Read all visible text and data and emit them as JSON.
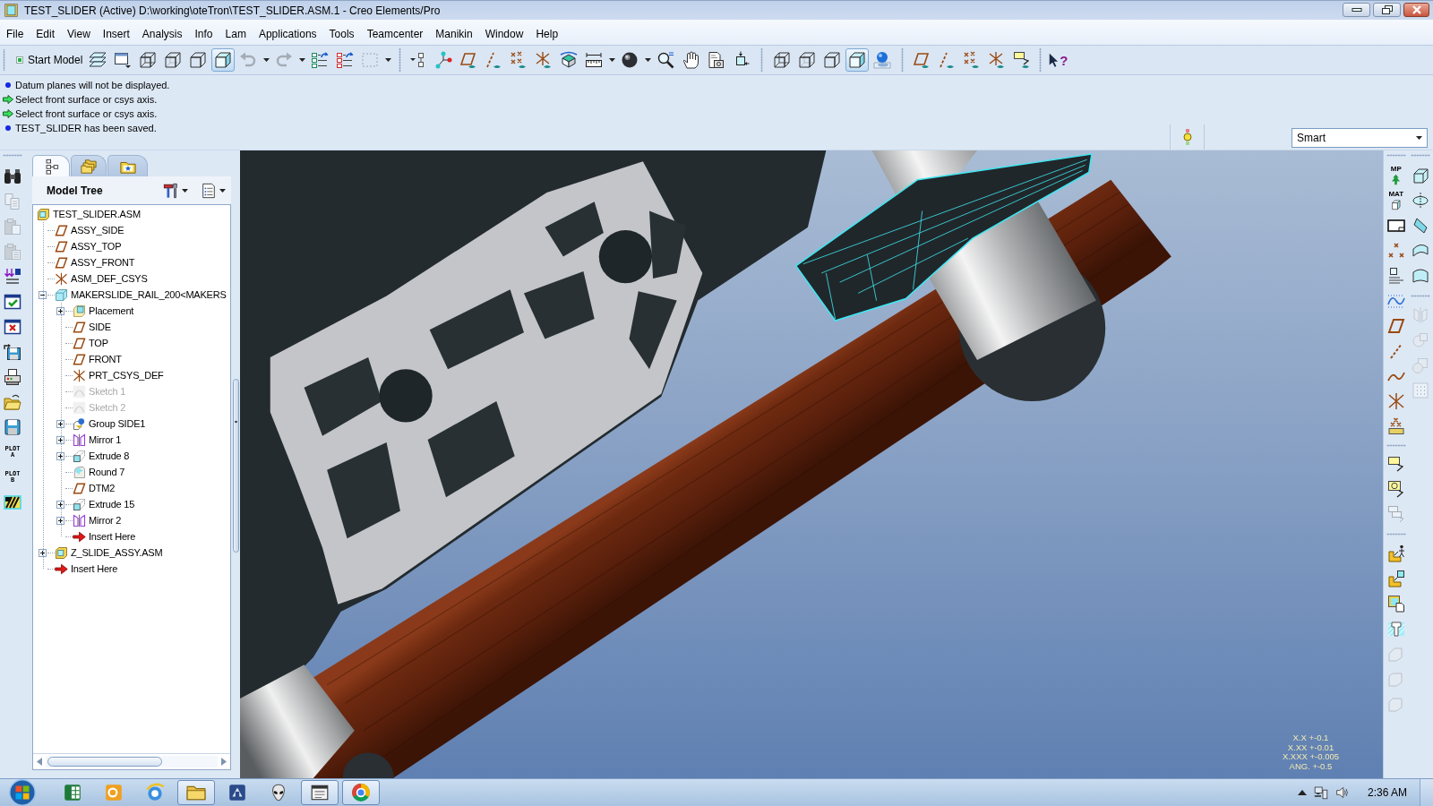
{
  "window": {
    "title": "TEST_SLIDER (Active) D:\\working\\oteTron\\TEST_SLIDER.ASM.1 - Creo Elements/Pro"
  },
  "menu": [
    "File",
    "Edit",
    "View",
    "Insert",
    "Analysis",
    "Info",
    "Lam",
    "Applications",
    "Tools",
    "Teamcenter",
    "Manikin",
    "Window",
    "Help"
  ],
  "toolbar": {
    "start_model": "Start Model",
    "groups": [
      [
        {
          "disabled": false,
          "pressed": false
        },
        {
          "disabled": false,
          "pressed": false
        },
        {
          "disabled": false,
          "pressed": false
        },
        {
          "disabled": false,
          "pressed": false
        },
        {
          "disabled": false,
          "pressed": false
        },
        {
          "disabled": false,
          "pressed": true
        },
        {
          "disabled": true,
          "pressed": false
        },
        {
          "disabled": true,
          "pressed": false
        },
        {
          "disabled": false,
          "pressed": false
        },
        {
          "disabled": false,
          "pressed": false
        },
        {
          "disabled": true,
          "pressed": false
        }
      ],
      [
        {
          "disabled": false,
          "pressed": false
        },
        {
          "disabled": false,
          "pressed": false
        },
        {
          "disabled": false,
          "pressed": false
        },
        {
          "disabled": false,
          "pressed": false
        },
        {
          "disabled": false,
          "pressed": false
        },
        {
          "disabled": false,
          "pressed": false
        },
        {
          "disabled": false,
          "pressed": false
        },
        {
          "disabled": false,
          "pressed": false
        },
        {
          "disabled": false,
          "pressed": false
        },
        {
          "disabled": false,
          "pressed": false
        },
        {
          "disabled": false,
          "pressed": false
        },
        {
          "disabled": false,
          "pressed": false
        },
        {
          "disabled": false,
          "pressed": false
        }
      ],
      [
        {
          "disabled": false,
          "pressed": false
        },
        {
          "disabled": false,
          "pressed": false
        },
        {
          "disabled": false,
          "pressed": false
        },
        {
          "disabled": false,
          "pressed": true
        },
        {
          "disabled": false,
          "pressed": false
        }
      ],
      [
        {
          "disabled": false,
          "pressed": false
        },
        {
          "disabled": false,
          "pressed": false
        },
        {
          "disabled": false,
          "pressed": false
        },
        {
          "disabled": false,
          "pressed": false
        },
        {
          "disabled": false,
          "pressed": false
        }
      ],
      [
        {
          "disabled": false,
          "pressed": false,
          "mark": "?"
        }
      ]
    ]
  },
  "messages": [
    {
      "kind": "info",
      "text": "Datum planes will not be displayed."
    },
    {
      "kind": "prompt",
      "text": "Select front surface or csys axis."
    },
    {
      "kind": "prompt",
      "text": "Select front surface or csys axis."
    },
    {
      "kind": "info",
      "text": "TEST_SLIDER has been saved."
    }
  ],
  "selection_filter": {
    "value": "Smart"
  },
  "left_toolbar": [
    {
      "disabled": false
    },
    {
      "disabled": true
    },
    {
      "disabled": true
    },
    {
      "disabled": true
    },
    {
      "disabled": false
    },
    {
      "disabled": false
    },
    {
      "disabled": false
    },
    {
      "disabled": false
    },
    {
      "disabled": false
    },
    {
      "disabled": false
    },
    {
      "disabled": false
    },
    {
      "disabled": false,
      "label": "PLOT",
      "sublabel": "A"
    },
    {
      "disabled": false,
      "label": "PLOT",
      "sublabel": "B"
    },
    {
      "disabled": false
    }
  ],
  "model_tree": {
    "tabs": [
      {
        "selected": true
      },
      {
        "selected": false
      },
      {
        "selected": false
      }
    ],
    "title": "Model Tree",
    "items": [
      {
        "label": "TEST_SLIDER.ASM",
        "kind": "assembly",
        "dimmed": false,
        "children": [
          {
            "label": "ASSY_SIDE",
            "kind": "datum-plane",
            "dimmed": false
          },
          {
            "label": "ASSY_TOP",
            "kind": "datum-plane",
            "dimmed": false
          },
          {
            "label": "ASSY_FRONT",
            "kind": "datum-plane",
            "dimmed": false
          },
          {
            "label": "ASM_DEF_CSYS",
            "kind": "csys",
            "dimmed": false
          },
          {
            "label": "MAKERSLIDE_RAIL_200<MAKERS",
            "kind": "part",
            "dimmed": false,
            "expanded": true,
            "children": [
              {
                "label": "Placement",
                "kind": "placement",
                "dimmed": false,
                "expanded": false
              },
              {
                "label": "SIDE",
                "kind": "datum-plane",
                "dimmed": false
              },
              {
                "label": "TOP",
                "kind": "datum-plane",
                "dimmed": false
              },
              {
                "label": "FRONT",
                "kind": "datum-plane",
                "dimmed": false
              },
              {
                "label": "PRT_CSYS_DEF",
                "kind": "csys",
                "dimmed": false
              },
              {
                "label": "Sketch 1",
                "kind": "sketch",
                "dimmed": true
              },
              {
                "label": "Sketch 2",
                "kind": "sketch",
                "dimmed": true
              },
              {
                "label": "Group SIDE1",
                "kind": "group",
                "dimmed": false,
                "expanded": false
              },
              {
                "label": "Mirror 1",
                "kind": "mirror",
                "dimmed": false,
                "expanded": false
              },
              {
                "label": "Extrude 8",
                "kind": "extrude",
                "dimmed": false,
                "expanded": false
              },
              {
                "label": "Round 7",
                "kind": "round",
                "dimmed": false
              },
              {
                "label": "DTM2",
                "kind": "datum-plane",
                "dimmed": false
              },
              {
                "label": "Extrude 15",
                "kind": "extrude",
                "dimmed": false,
                "expanded": false
              },
              {
                "label": "Mirror 2",
                "kind": "mirror",
                "dimmed": false,
                "expanded": false
              },
              {
                "label": "Insert Here",
                "kind": "insert",
                "dimmed": false
              }
            ]
          },
          {
            "label": "Z_SLIDE_ASSY.ASM",
            "kind": "assembly",
            "dimmed": false,
            "expanded": false
          },
          {
            "label": "Insert Here",
            "kind": "insert",
            "dimmed": false
          }
        ]
      }
    ]
  },
  "viewport": {
    "tolerances": [
      "X.X +-0.1",
      "X.XX +-0.01",
      "X.XXX +-0.005",
      "ANG. +-0.5"
    ]
  },
  "right_toolbar": {
    "columns": [
      [
        [
          {
            "disabled": false,
            "label": "MP"
          },
          {
            "disabled": false,
            "label": "MAT"
          },
          {
            "disabled": false
          },
          {
            "disabled": false
          },
          {
            "disabled": false
          },
          {
            "disabled": false
          },
          {
            "disabled": false
          },
          {
            "disabled": false
          },
          {
            "disabled": false
          },
          {
            "disabled": false
          },
          {
            "disabled": false
          }
        ],
        [
          {
            "disabled": false
          },
          {
            "disabled": false
          },
          {
            "disabled": true
          }
        ],
        [
          {
            "disabled": false
          },
          {
            "disabled": false
          },
          {
            "disabled": false
          },
          {
            "disabled": false
          },
          {
            "disabled": true
          },
          {
            "disabled": true
          },
          {
            "disabled": true
          }
        ]
      ],
      [
        [
          {
            "disabled": false
          },
          {
            "disabled": false
          },
          {
            "disabled": false
          },
          {
            "disabled": false
          },
          {
            "disabled": false
          }
        ],
        [
          {
            "disabled": true
          },
          {
            "disabled": true
          },
          {
            "disabled": true
          },
          {
            "disabled": true
          }
        ]
      ]
    ]
  },
  "taskbar": {
    "apps": [
      {
        "open": false
      },
      {
        "open": false
      },
      {
        "open": false
      },
      {
        "open": true
      },
      {
        "open": false
      },
      {
        "open": false
      },
      {
        "open": true
      },
      {
        "open": true
      }
    ],
    "clock": "2:36 AM"
  }
}
